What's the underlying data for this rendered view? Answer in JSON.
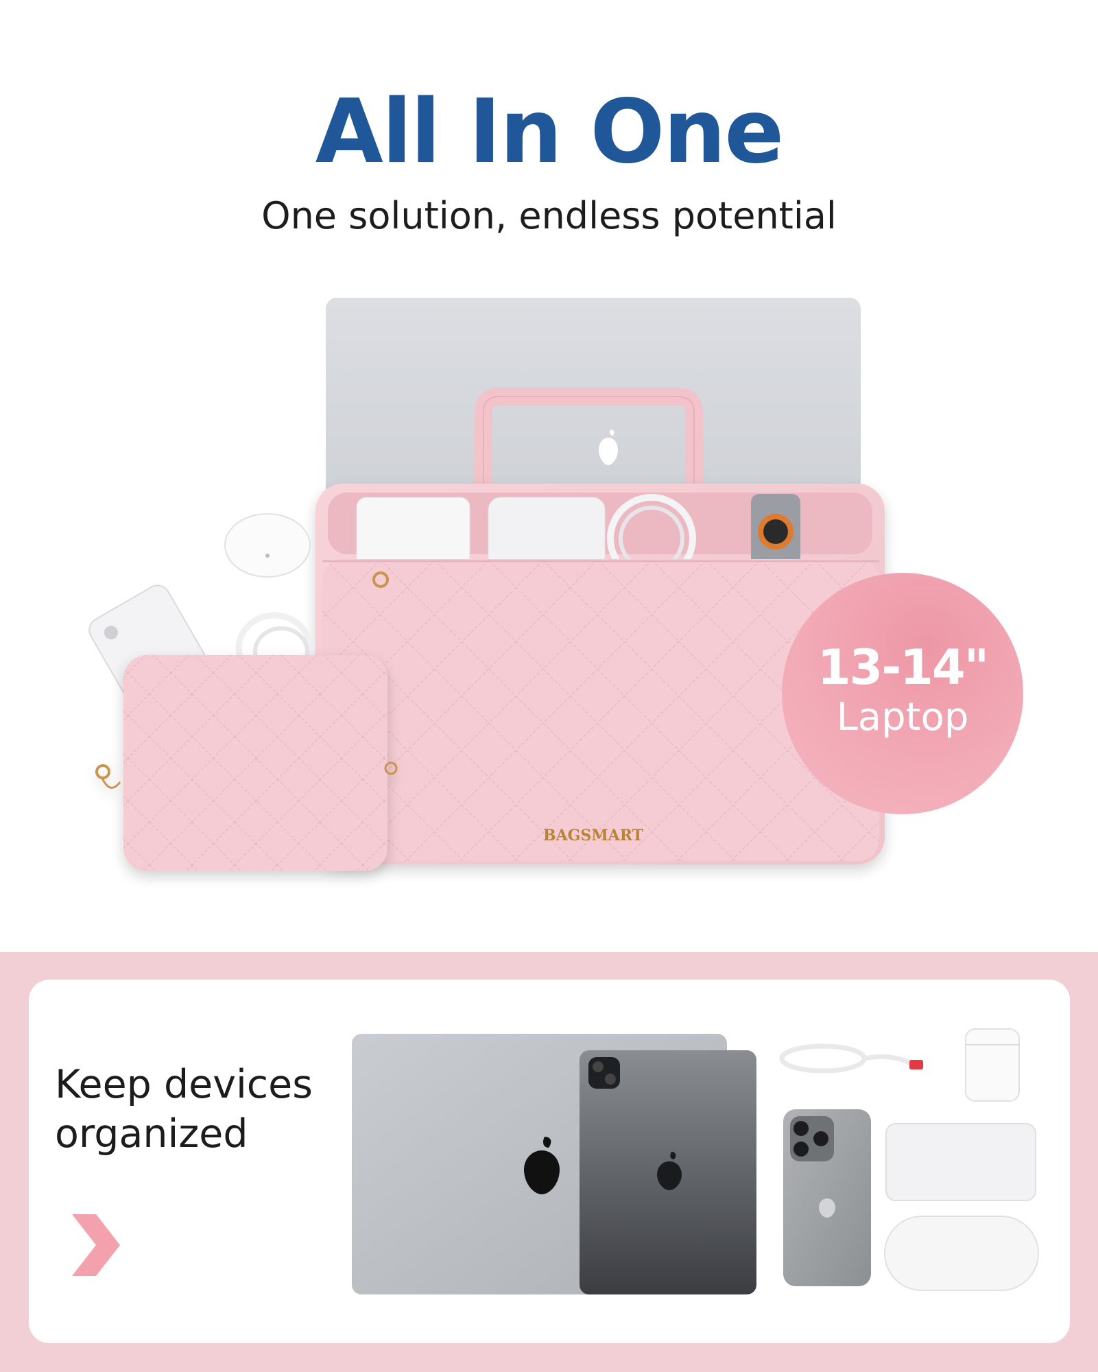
{
  "header": {
    "title": "All In One",
    "subtitle": "One solution, endless potential"
  },
  "product": {
    "brand": "BAGSMART",
    "size_badge": {
      "number": "13-14\"",
      "word": "Laptop"
    }
  },
  "feature_card": {
    "text_line1": "Keep devices",
    "text_line2": "organized"
  },
  "colors": {
    "title_blue": "#1f5799",
    "bag_pink": "#f4c9d0",
    "band_pink": "#f1cfd5",
    "badge_pink": "#f2aab6",
    "chevron_pink": "#f2a1ad"
  },
  "icons": [
    "apple-logo-icon",
    "chevron-right-icon"
  ]
}
